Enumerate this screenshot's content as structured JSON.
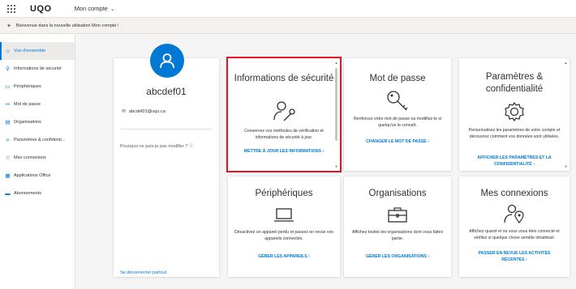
{
  "topbar": {
    "logo": "UQO",
    "account_menu": "Mon compte"
  },
  "banner": {
    "text": "Bienvenue dans la nouvelle utilisation Mon compte !"
  },
  "sidebar": {
    "items": [
      {
        "label": "Vue d'ensemble"
      },
      {
        "label": "Informations de sécurité"
      },
      {
        "label": "Périphériques"
      },
      {
        "label": "Mot de passe"
      },
      {
        "label": "Organisations"
      },
      {
        "label": "Paramètres & confidenti..."
      },
      {
        "label": "Mes connexions"
      },
      {
        "label": "Applications Office"
      },
      {
        "label": "Abonnements"
      }
    ]
  },
  "profile": {
    "username": "abcdef01",
    "email": "abcdef01@uqo.ca",
    "cant_modify": "Pourquoi ne puis-je pas modifier ?",
    "signout": "Se déconnecter partout"
  },
  "tiles": {
    "security": {
      "title": "Informations de sécurité",
      "desc": "Conservez vos méthodes de vérification et informations de sécurité à jour.",
      "link": "METTRE À JOUR LES INFORMATIONS"
    },
    "password": {
      "title": "Mot de passe",
      "desc": "Renforcez votre mot de passe ou modifiez-le si quelqu'un le connaît.",
      "link": "CHANGER LE MOT DE PASSE"
    },
    "privacy": {
      "title": "Paramètres & confidentialité",
      "desc": "Personnalisez les paramètres de votre compte et découvrez comment vos données sont utilisées.",
      "link": "AFFICHER LES PARAMÈTRES ET LA CONFIDENTIALITÉ"
    },
    "devices": {
      "title": "Périphériques",
      "desc": "Désactivez un appareil perdu et passez en revue vos appareils connectés.",
      "link": "GÉRER LES APPAREILS"
    },
    "orgs": {
      "title": "Organisations",
      "desc": "Affichez toutes les organisations dont vous faites partie.",
      "link": "GÉRER LES ORGANISATIONS"
    },
    "signins": {
      "title": "Mes connexions",
      "desc": "Affichez quand et où vous vous êtes connecté et vérifiez si quelque chose semble inhabituel.",
      "link": "PASSER EN REVUE LES ACTIVITÉS RÉCENTES"
    }
  },
  "colors": {
    "accent": "#0078d4",
    "highlight": "#e81123"
  }
}
